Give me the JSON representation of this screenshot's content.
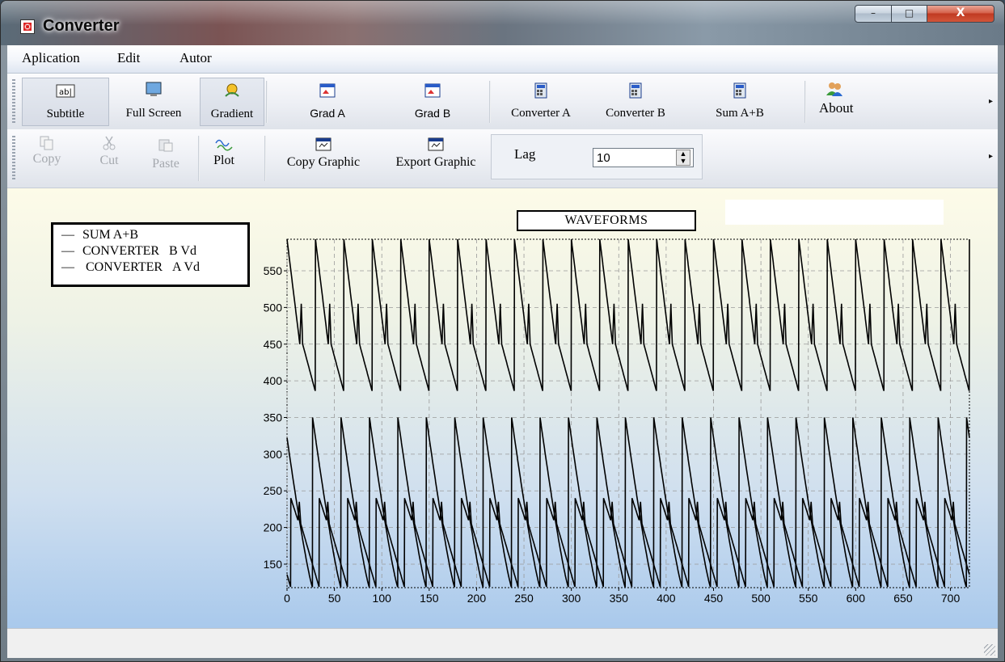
{
  "window": {
    "title": "Converter",
    "controls": {
      "minimize": "–",
      "maximize": "□",
      "close": "X"
    }
  },
  "menu": [
    "Aplication",
    "Edit",
    "Autor"
  ],
  "toolbar1": {
    "subtitle": "Subtitle",
    "full_screen": "Full Screen",
    "gradient": "Gradient",
    "grad_a": "Grad A",
    "grad_b": "Grad B",
    "converter_a": "Converter A",
    "converter_b": "Converter B",
    "sum_ab": "Sum A+B",
    "about": "About",
    "more": "▸"
  },
  "toolbar2": {
    "copy": "Copy",
    "cut": "Cut",
    "paste": "Paste",
    "plot": "Plot",
    "copy_graphic": "Copy Graphic",
    "export_graphic": "Export Graphic",
    "lag_label": "Lag",
    "lag_value": "10",
    "more": "▸"
  },
  "legend": {
    "entries": [
      {
        "line": "—",
        "name": "SUM A+B",
        "suffix": ""
      },
      {
        "line": "—",
        "name": "CONVERTER",
        "suffix": "B Vd"
      },
      {
        "line": "—",
        "name": "CONVERTER",
        "suffix": "A Vd"
      }
    ]
  },
  "chart_data": {
    "type": "line",
    "title": "WAVEFORMS",
    "xlabel": "",
    "ylabel": "",
    "xlim": [
      0,
      720
    ],
    "ylim": [
      118,
      593
    ],
    "x_ticks": [
      0,
      50,
      100,
      150,
      200,
      250,
      300,
      350,
      400,
      450,
      500,
      550,
      600,
      650,
      700
    ],
    "y_ticks": [
      150,
      200,
      250,
      300,
      350,
      400,
      450,
      500,
      550
    ],
    "grid": true,
    "legend_position": "top-left",
    "period": 30,
    "series": [
      {
        "name": "SUM A+B",
        "description": "sawtooth with ripple",
        "min": 385,
        "max": 593
      },
      {
        "name": "CONVERTER B Vd",
        "description": "decaying sawtooth",
        "min": 118,
        "max": 350
      },
      {
        "name": "CONVERTER A Vd",
        "description": "ramp with ripple",
        "min": 118,
        "max": 240
      }
    ]
  }
}
